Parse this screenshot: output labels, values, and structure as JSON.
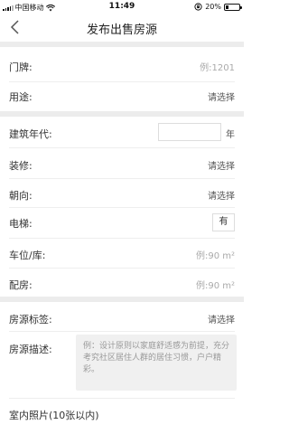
{
  "status_bar": {
    "carrier": "中国移动",
    "time": "11:49",
    "battery_text": "20%",
    "battery_level": 0.2
  },
  "nav": {
    "title": "发布出售房源",
    "back_icon": "chevron-left-icon"
  },
  "form": {
    "door_number": {
      "label": "门牌:",
      "placeholder": "例:1201"
    },
    "usage": {
      "label": "用途:",
      "value": "请选择"
    },
    "build_year": {
      "label": "建筑年代:",
      "value": "",
      "unit": "年"
    },
    "decoration": {
      "label": "装修:",
      "value": "请选择"
    },
    "orientation": {
      "label": "朝向:",
      "value": "请选择"
    },
    "elevator": {
      "label": "电梯:",
      "value": "有"
    },
    "parking": {
      "label": "车位/库:",
      "placeholder": "例:90 m²"
    },
    "accessory_room": {
      "label": "配房:",
      "placeholder": "例:90 m²"
    },
    "tags": {
      "label": "房源标签:",
      "value": "请选择"
    },
    "description": {
      "label": "房源描述:",
      "placeholder": "例：设计原则以家庭舒适感为前提，充分考究社区居住人群的居住习惯，户户精彩。"
    },
    "photos": {
      "label": "室内照片(10张以内)"
    }
  }
}
